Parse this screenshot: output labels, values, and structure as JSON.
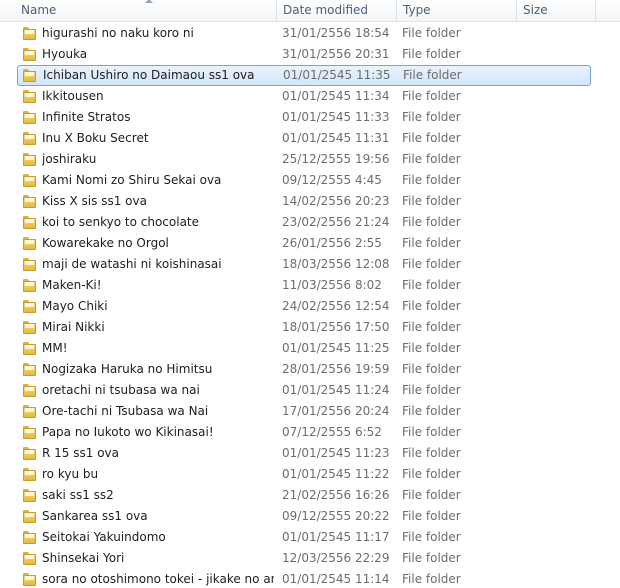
{
  "columns": {
    "name": "Name",
    "date": "Date modified",
    "type": "Type",
    "size": "Size"
  },
  "selected_index": 2,
  "icon": "folder-icon",
  "items": [
    {
      "name": "higurashi no naku koro ni",
      "date": "31/01/2556 18:54",
      "type": "File folder"
    },
    {
      "name": "Hyouka",
      "date": "31/01/2556 20:31",
      "type": "File folder"
    },
    {
      "name": "Ichiban Ushiro no Daimaou ss1 ova",
      "date": "01/01/2545 11:35",
      "type": "File folder"
    },
    {
      "name": "Ikkitousen",
      "date": "01/01/2545 11:34",
      "type": "File folder"
    },
    {
      "name": "Infinite Stratos",
      "date": "01/01/2545 11:33",
      "type": "File folder"
    },
    {
      "name": "Inu X Boku Secret",
      "date": "01/01/2545 11:31",
      "type": "File folder"
    },
    {
      "name": "joshiraku",
      "date": "25/12/2555 19:56",
      "type": "File folder"
    },
    {
      "name": "Kami Nomi zo Shiru Sekai ova",
      "date": "09/12/2555 4:45",
      "type": "File folder"
    },
    {
      "name": "Kiss X sis ss1 ova",
      "date": "14/02/2556 20:23",
      "type": "File folder"
    },
    {
      "name": "koi to senkyo to chocolate",
      "date": "23/02/2556 21:24",
      "type": "File folder"
    },
    {
      "name": "Kowarekake no Orgol",
      "date": "26/01/2556 2:55",
      "type": "File folder"
    },
    {
      "name": "maji de watashi ni koishinasai",
      "date": "18/03/2556 12:08",
      "type": "File folder"
    },
    {
      "name": "Maken-Ki!",
      "date": "11/03/2556 8:02",
      "type": "File folder"
    },
    {
      "name": "Mayo Chiki",
      "date": "24/02/2556 12:54",
      "type": "File folder"
    },
    {
      "name": "Mirai Nikki",
      "date": "18/01/2556 17:50",
      "type": "File folder"
    },
    {
      "name": "MM!",
      "date": "01/01/2545 11:25",
      "type": "File folder"
    },
    {
      "name": "Nogizaka Haruka no Himitsu",
      "date": "28/01/2556 19:59",
      "type": "File folder"
    },
    {
      "name": "oretachi ni tsubasa wa nai",
      "date": "01/01/2545 11:24",
      "type": "File folder"
    },
    {
      "name": "Ore-tachi ni Tsubasa wa Nai",
      "date": "17/01/2556 20:24",
      "type": "File folder"
    },
    {
      "name": "Papa no Iukoto wo Kikinasai!",
      "date": "07/12/2555 6:52",
      "type": "File folder"
    },
    {
      "name": "R 15 ss1 ova",
      "date": "01/01/2545 11:23",
      "type": "File folder"
    },
    {
      "name": "ro kyu bu",
      "date": "01/01/2545 11:22",
      "type": "File folder"
    },
    {
      "name": "saki ss1 ss2",
      "date": "21/02/2556 16:26",
      "type": "File folder"
    },
    {
      "name": "Sankarea ss1 ova",
      "date": "09/12/2555 20:22",
      "type": "File folder"
    },
    {
      "name": "Seitokai Yakuindomo",
      "date": "01/01/2545 11:17",
      "type": "File folder"
    },
    {
      "name": "Shinsekai Yori",
      "date": "12/03/2556 22:29",
      "type": "File folder"
    },
    {
      "name": "sora no otoshimono tokei - jikake no ang...",
      "date": "01/01/2545 11:14",
      "type": "File folder"
    }
  ]
}
